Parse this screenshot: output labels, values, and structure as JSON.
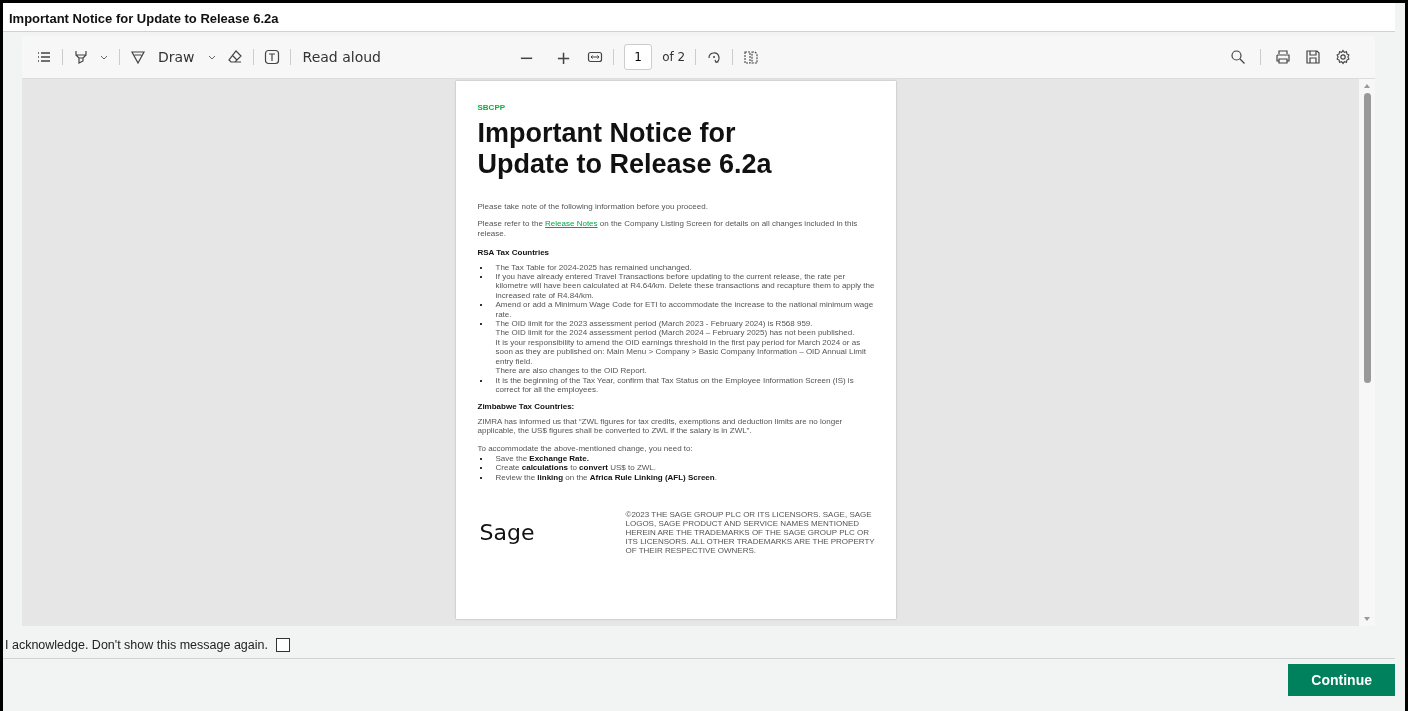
{
  "window": {
    "title": "Important Notice for Update to Release 6.2a"
  },
  "toolbar": {
    "draw_label": "Draw",
    "read_aloud": "Read aloud",
    "zoom_out": "−",
    "zoom_in": "+",
    "page": "1",
    "page_count": "of 2"
  },
  "document": {
    "brand_label": "SBCPP",
    "heading": "Important Notice for Update to Release 6.2a",
    "blocks": [
      {
        "kind": "paragraph",
        "text": "Please take note of the following information before you proceed."
      },
      {
        "kind": "link_paragraph",
        "before": "Please refer to the ",
        "link": "Release Notes",
        "after": " on the Company Listing Screen for details on all changes included in this release."
      },
      {
        "kind": "heading",
        "text": "RSA Tax Countries"
      },
      {
        "kind": "bullets",
        "items": [
          {
            "lines": [
              "The Tax Table for 2024-2025 has remained unchanged."
            ]
          },
          {
            "lines": [
              "If you have already entered Travel Transactions before updating to the current release, the rate per kilometre will have been calculated at R4.64/km. Delete these transactions and recapture them to apply the increased rate of R4.84/km."
            ]
          },
          {
            "lines": [
              "Amend or add a Minimum Wage Code for ETI to accommodate the increase to the national minimum wage rate."
            ]
          },
          {
            "lines": [
              "The OID limit for the 2023 assessment period (March 2023 - February 2024) is R568 959.",
              "The OID limit for the 2024 assessment period (March 2024 – February 2025) has not been published.",
              "It is your responsibility to amend the OID earnings threshold in the first pay period for March 2024 or as soon as they are published on:  Main Menu > Company > Basic Company Information – OID Annual Limit entry field.",
              "There are also changes to the OID Report."
            ]
          },
          {
            "lines": [
              "It is the beginning of the Tax Year, confirm that Tax Status on the Employee Information Screen (IS) is correct for all the employees."
            ]
          }
        ]
      },
      {
        "kind": "heading",
        "text": "Zimbabwe Tax Countries:"
      },
      {
        "kind": "paragraph",
        "text": "ZIMRA has informed us that “ZWL figures for tax credits, exemptions and deduction limits are no longer applicable, the US$ figures shall be converted to ZWL if the salary is in ZWL”."
      },
      {
        "kind": "lead",
        "text": "To accommodate the above-mentioned change, you need to:"
      },
      {
        "kind": "bullets",
        "items": [
          {
            "lines": [
              "Save the **Exchange Rate.**"
            ]
          },
          {
            "lines": [
              "Create **calculations** to **convert** US$ to ZWL."
            ]
          },
          {
            "lines": [
              "Review the **linking** on the **Africa Rule Linking (AFL) Screen**."
            ]
          }
        ]
      }
    ],
    "logo": "Sage",
    "legal": "©2023 THE SAGE GROUP PLC OR ITS LICENSORS. SAGE, SAGE LOGOS, SAGE PRODUCT AND SERVICE NAMES MENTIONED HEREIN ARE THE TRADEMARKS OF THE SAGE GROUP PLC OR ITS LICENSORS. ALL OTHER TRADEMARKS ARE THE PROPERTY OF THEIR RESPECTIVE OWNERS."
  },
  "acknowledge": {
    "label": "I acknowledge. Don't show this message again.",
    "checked": false
  },
  "buttons": [
    {
      "label": "Continue",
      "kind": "primary"
    }
  ]
}
